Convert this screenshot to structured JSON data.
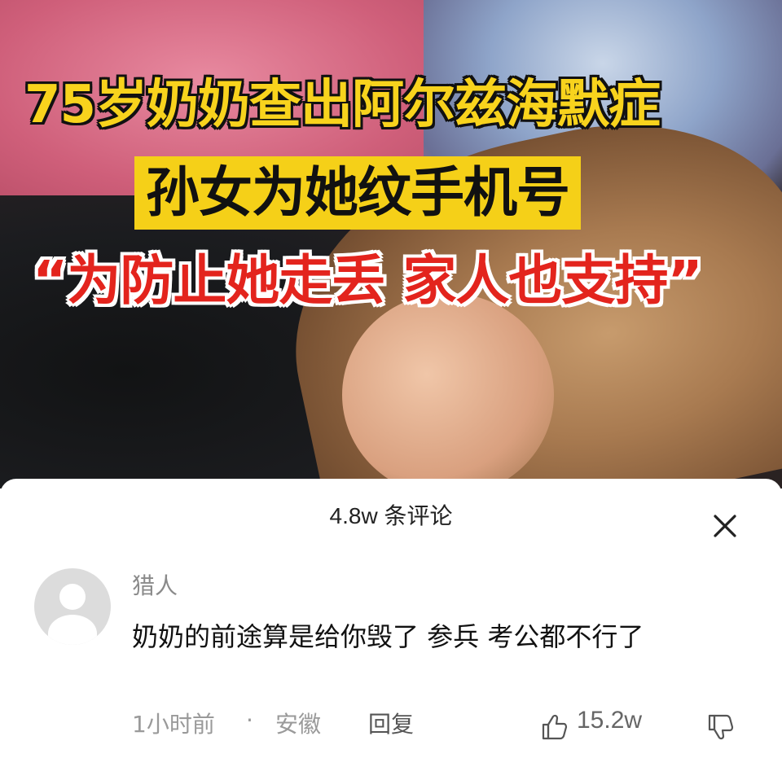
{
  "video": {
    "headline_line1": "75岁奶奶查出阿尔兹海默症",
    "headline_line2": "孙女为她纹手机号",
    "headline_line3": "“为防止她走丢 家人也支持”",
    "colors": {
      "line1_fill": "#f8d31d",
      "line2_bg": "#f5d018",
      "line3_fill": "#e3241d"
    }
  },
  "comments_panel": {
    "title": "4.8w 条评论",
    "close_icon": "close-icon"
  },
  "comment": {
    "avatar_icon": "default-avatar",
    "username": "猎人",
    "text": "奶奶的前途算是给你毁了 参兵 考公都不行了",
    "time": "1小时前",
    "separator": "·",
    "location": "安徽",
    "reply_label": "回复",
    "like_icon": "thumbs-up-icon",
    "like_count": "15.2w",
    "dislike_icon": "thumbs-down-icon"
  }
}
